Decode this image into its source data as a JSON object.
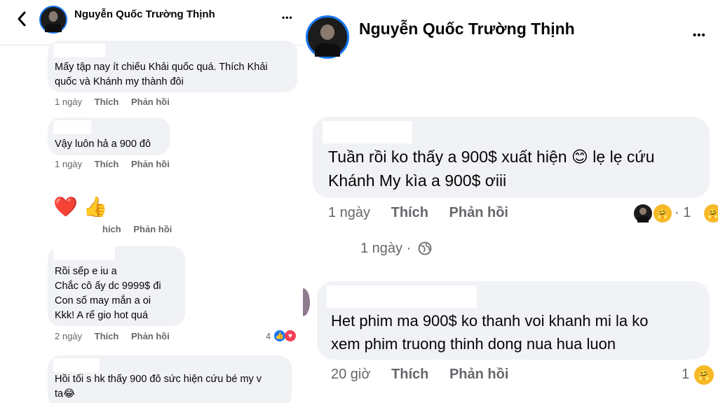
{
  "left": {
    "header": {
      "name": "Nguyễn Quốc Trường Thịnh",
      "more": "•••",
      "back": "‹"
    },
    "comments": [
      {
        "lines": [
          "Mấy tập nay ít chiếu Khải quốc quá. Thích Khải",
          "quốc và Khánh my thành đôi"
        ],
        "time": "1 ngày",
        "like": "Thích",
        "reply": "Phản hồi"
      },
      {
        "lines": [
          "Vậy luôn hả a 900 đô"
        ],
        "time": "1 ngày",
        "like": "Thích",
        "reply": "Phản hồi"
      },
      {
        "emoji": "❤️ 👍",
        "like": "hích",
        "reply": "Phản hồi"
      },
      {
        "lines": [
          "Rồi sếp e iu a",
          "Chắc cô ấy dc 9999$ đi",
          "Con số may mắn a oi",
          "Kkk! A rể gio hot quá"
        ],
        "time": "2 ngày",
        "like": "Thích",
        "reply": "Phản hồi",
        "reaction_count": "4"
      },
      {
        "lines": [
          "Hồi tối s hk thấy 900 đô sức hiện cứu bé my v",
          "ta😂"
        ]
      }
    ]
  },
  "right": {
    "header": {
      "name": "Nguyễn Quốc Trường Thịnh",
      "more": "•••"
    },
    "comments": [
      {
        "lines": [
          "Tuần rồi ko thấy a 900$ xuất hiện 😊 lẹ lẹ cứu",
          "Khánh My kìa a 900$ ơiii"
        ],
        "time": "1 ngày",
        "like": "Thích",
        "reply": "Phản hồi",
        "reaction_count": "1",
        "sub_time": "1 ngày ·"
      },
      {
        "lines": [
          "Het phim ma 900$ ko thanh voi khanh mi la ko",
          "xem phim truong thinh dong nua hua luon"
        ],
        "time": "20 giờ",
        "like": "Thích",
        "reply": "Phản hồi",
        "reaction_count": "1"
      }
    ]
  },
  "colors": {
    "bubble": "#f0f2f5",
    "meta": "#65676b",
    "like_blue": "#1877f2",
    "love_red": "#f33e58",
    "heart": "#d11f1f",
    "thumbs": "#f5c33b"
  }
}
